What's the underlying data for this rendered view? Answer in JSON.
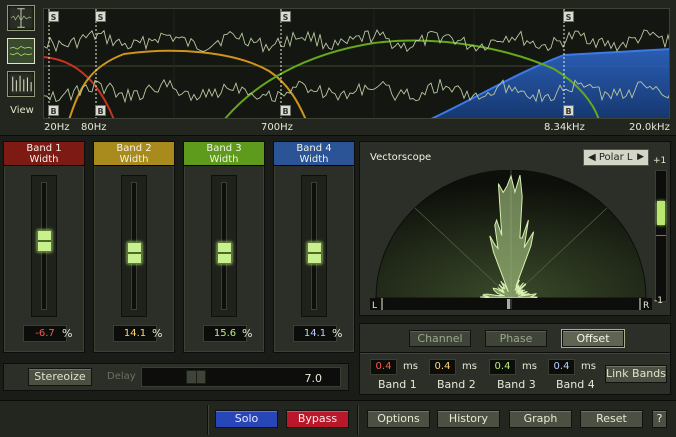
{
  "view": {
    "label": "View"
  },
  "spectrum": {
    "marker_s": "S",
    "marker_b": "B",
    "freq_labels": [
      "20Hz",
      "80Hz",
      "700Hz",
      "8.34kHz",
      "20.0kHz"
    ]
  },
  "bands": [
    {
      "name": "Band 1",
      "sub": "Width",
      "value": "-6.7",
      "unit": "%",
      "color": "#7e1a14",
      "value_color": "#ff5a4a",
      "level": 0.55
    },
    {
      "name": "Band 2",
      "sub": "Width",
      "value": "14.1",
      "unit": "%",
      "color": "#a98a1c",
      "value_color": "#ffd870",
      "level": 0.45
    },
    {
      "name": "Band 3",
      "sub": "Width",
      "value": "15.6",
      "unit": "%",
      "color": "#5e9a1c",
      "value_color": "#b8f07a",
      "level": 0.45
    },
    {
      "name": "Band 4",
      "sub": "Width",
      "value": "14.1",
      "unit": "%",
      "color": "#2a5496",
      "value_color": "#b6d2ff",
      "level": 0.45
    }
  ],
  "stereoize": {
    "label": "Stereoize"
  },
  "delay": {
    "label": "Delay",
    "value": "7.0"
  },
  "scope": {
    "title": "Vectorscope",
    "mode_select": "Polar L",
    "left_label": "L",
    "right_label": "R",
    "meter_top": "+1",
    "meter_bottom": "-1"
  },
  "modes": {
    "channel": "Channel",
    "phase": "Phase",
    "offset": "Offset"
  },
  "offsets": [
    {
      "value": "0.4",
      "unit": "ms",
      "name": "Band 1",
      "color": "#ff5a4a"
    },
    {
      "value": "0.4",
      "unit": "ms",
      "name": "Band 2",
      "color": "#ffd870"
    },
    {
      "value": "0.4",
      "unit": "ms",
      "name": "Band 3",
      "color": "#b8f07a"
    },
    {
      "value": "0.4",
      "unit": "ms",
      "name": "Band 4",
      "color": "#b6d2ff"
    }
  ],
  "link_bands": "Link Bands",
  "bottom": {
    "solo": "Solo",
    "bypass": "Bypass",
    "options": "Options",
    "history": "History",
    "graph": "Graph",
    "reset": "Reset",
    "help": "?"
  }
}
